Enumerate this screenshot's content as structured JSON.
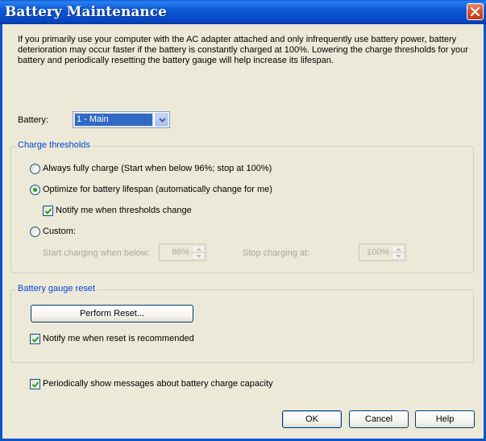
{
  "window": {
    "title": "Battery Maintenance",
    "close_icon": "close-icon"
  },
  "description": "If you primarily use your computer with the AC adapter attached and only infrequently use battery power, battery deterioration may occur faster if the battery is constantly charged at 100%. Lowering the charge thresholds for your battery and periodically resetting the battery gauge will help increase its lifespan.",
  "battery": {
    "label": "Battery:",
    "selected": "1 - Main"
  },
  "charge_thresholds": {
    "title": "Charge thresholds",
    "options": [
      {
        "label": "Always fully charge (Start when below 96%; stop at 100%)",
        "checked": false
      },
      {
        "label": "Optimize for battery lifespan (automatically change for me)",
        "checked": true
      },
      {
        "label": "Custom:",
        "checked": false
      }
    ],
    "notify_label": "Notify me when thresholds change",
    "notify_checked": true,
    "start_label": "Start charging when below:",
    "start_value": "96%",
    "stop_label": "Stop charging at:",
    "stop_value": "100%"
  },
  "gauge_reset": {
    "title": "Battery gauge reset",
    "button_label": "Perform Reset...",
    "notify_label": "Notify me when reset is recommended",
    "notify_checked": true
  },
  "periodic": {
    "label": "Periodically show messages about battery charge capacity",
    "checked": true
  },
  "buttons": {
    "ok": "OK",
    "cancel": "Cancel",
    "help": "Help"
  },
  "colors": {
    "titlebar": "#0b5ad4",
    "group_title": "#0046d5",
    "window_bg": "#ece9d8",
    "selection": "#316ac5"
  }
}
